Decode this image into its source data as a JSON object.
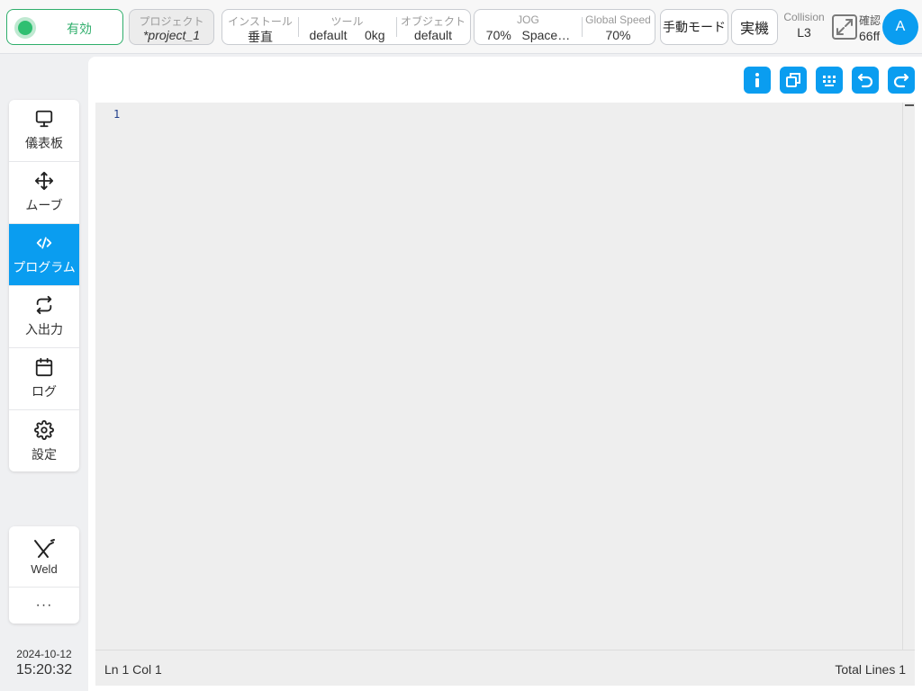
{
  "topbar": {
    "enable_label": "有効",
    "project": {
      "caption": "プロジェクト",
      "value": "*project_1"
    },
    "install": {
      "caption": "インストール",
      "value": "垂直"
    },
    "tool": {
      "caption": "ツール",
      "name": "default",
      "weight": "0kg"
    },
    "object": {
      "caption": "オブジェクト",
      "value": "default"
    },
    "jog": {
      "caption": "JOG",
      "speed": "70%",
      "mode": "Space…"
    },
    "global_speed": {
      "caption": "Global Speed",
      "value": "70%"
    },
    "manual_mode": "手動モード",
    "real_machine": "実機",
    "collision": {
      "caption": "Collision",
      "value": "L3"
    },
    "confirm": {
      "caption": "確認",
      "value": "66ff"
    },
    "avatar_letter": "A",
    "colors": {
      "accent": "#0a9df0",
      "enabled": "#2fae6b"
    }
  },
  "sidebar": {
    "items": [
      {
        "label": "儀表板",
        "icon": "monitor-icon"
      },
      {
        "label": "ムーブ",
        "icon": "move-arrows-icon"
      },
      {
        "label": "プログラム",
        "icon": "code-icon",
        "active": true
      },
      {
        "label": "入出力",
        "icon": "repeat-icon"
      },
      {
        "label": "ログ",
        "icon": "calendar-icon"
      },
      {
        "label": "設定",
        "icon": "gear-icon"
      }
    ],
    "weld_label": "Weld",
    "more_label": "···"
  },
  "clock": {
    "date": "2024-10-12",
    "time": "15:20:32"
  },
  "toolbar": [
    "info-icon",
    "copy-icon",
    "keyboard-icon",
    "undo-icon",
    "redo-icon"
  ],
  "editor": {
    "line_numbers": [
      "1"
    ],
    "status_left": "Ln 1 Col 1",
    "status_right": "Total Lines 1"
  }
}
